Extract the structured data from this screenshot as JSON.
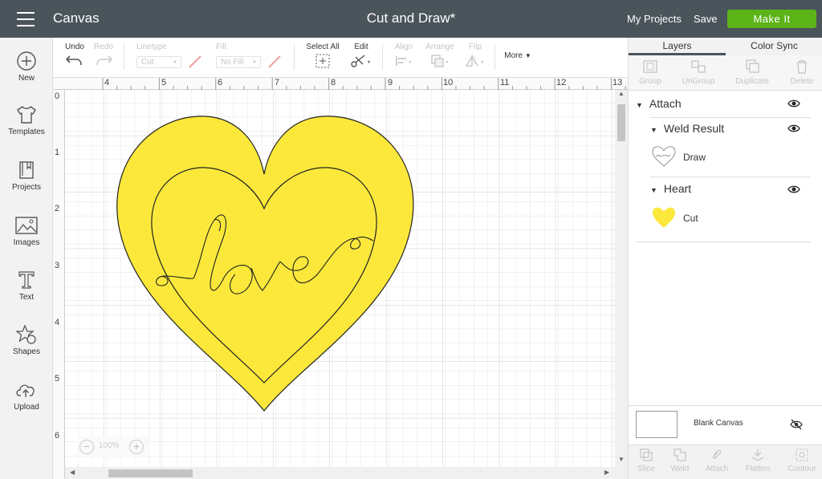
{
  "header": {
    "app_title": "Canvas",
    "doc_title": "Cut and Draw*",
    "my_projects": "My Projects",
    "save": "Save",
    "make_it": "Make It"
  },
  "toolbar": {
    "undo": "Undo",
    "redo": "Redo",
    "linetype_label": "Linetype",
    "linetype_value": "Cut",
    "fill_label": "Fill",
    "fill_value": "No Fill",
    "select_all": "Select All",
    "edit": "Edit",
    "align": "Align",
    "arrange": "Arrange",
    "flip": "Flip",
    "more": "More"
  },
  "leftbar": {
    "items": [
      {
        "label": "New",
        "icon": "plus-circle-icon"
      },
      {
        "label": "Templates",
        "icon": "shirt-icon"
      },
      {
        "label": "Projects",
        "icon": "bookmark-book-icon"
      },
      {
        "label": "Images",
        "icon": "image-icon"
      },
      {
        "label": "Text",
        "icon": "text-t-icon"
      },
      {
        "label": "Shapes",
        "icon": "shapes-icon"
      },
      {
        "label": "Upload",
        "icon": "cloud-upload-icon"
      }
    ]
  },
  "canvas": {
    "ruler_x": [
      "4",
      "5",
      "6",
      "7",
      "8",
      "9",
      "10",
      "11",
      "12",
      "13"
    ],
    "ruler_y": [
      "0",
      "1",
      "2",
      "3",
      "4",
      "5",
      "6"
    ],
    "zoom_value": "100%",
    "design_text": "love",
    "heart_color": "#fbe83b"
  },
  "rightpanel": {
    "tabs": [
      "Layers",
      "Color Sync"
    ],
    "tools": [
      "Group",
      "UnGroup",
      "Duplicate",
      "Delete"
    ],
    "group_name": "Attach",
    "layers": [
      {
        "name": "Weld Result",
        "item": "Draw"
      },
      {
        "name": "Heart",
        "item": "Cut"
      }
    ],
    "blank_canvas": "Blank Canvas",
    "bottom_tools": [
      "Slice",
      "Weld",
      "Attach",
      "Flatten",
      "Contour"
    ]
  },
  "colors": {
    "topbar": "#4a545b",
    "make_it_green": "#5cb318",
    "heart_yellow": "#fbe83b"
  }
}
